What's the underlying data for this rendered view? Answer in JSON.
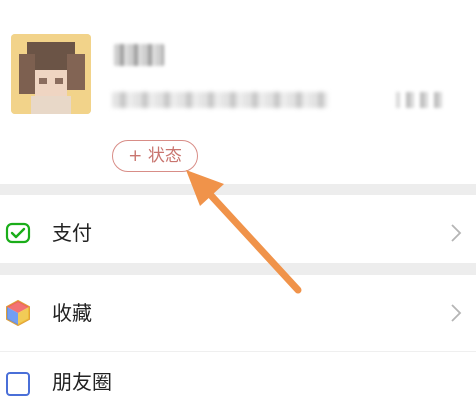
{
  "profile": {
    "status_button_label": "+ 状态"
  },
  "menu": {
    "items": [
      {
        "label": "支付",
        "icon": "pay-icon"
      },
      {
        "label": "收藏",
        "icon": "favorites-icon"
      },
      {
        "label": "朋友圈",
        "icon": "moments-icon"
      }
    ]
  },
  "colors": {
    "accent_arrow": "#f0934a",
    "status_outline": "#d88d87",
    "pay_green": "#1aad19"
  }
}
